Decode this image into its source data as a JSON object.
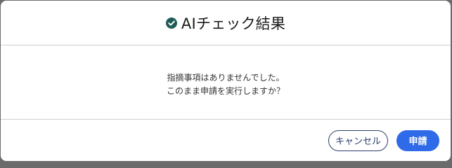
{
  "dialog": {
    "title": "AIチェック結果",
    "title_icon": "check-circle-icon",
    "message_lines": [
      "指摘事項はありませんでした。",
      "このまま申請を実行しますか？"
    ],
    "buttons": {
      "cancel_label": "キャンセル",
      "submit_label": "申請"
    }
  },
  "colors": {
    "icon_green": "#1d5c5a",
    "submit_blue": "#2f6ae8",
    "cancel_border": "#2c3e6b"
  }
}
